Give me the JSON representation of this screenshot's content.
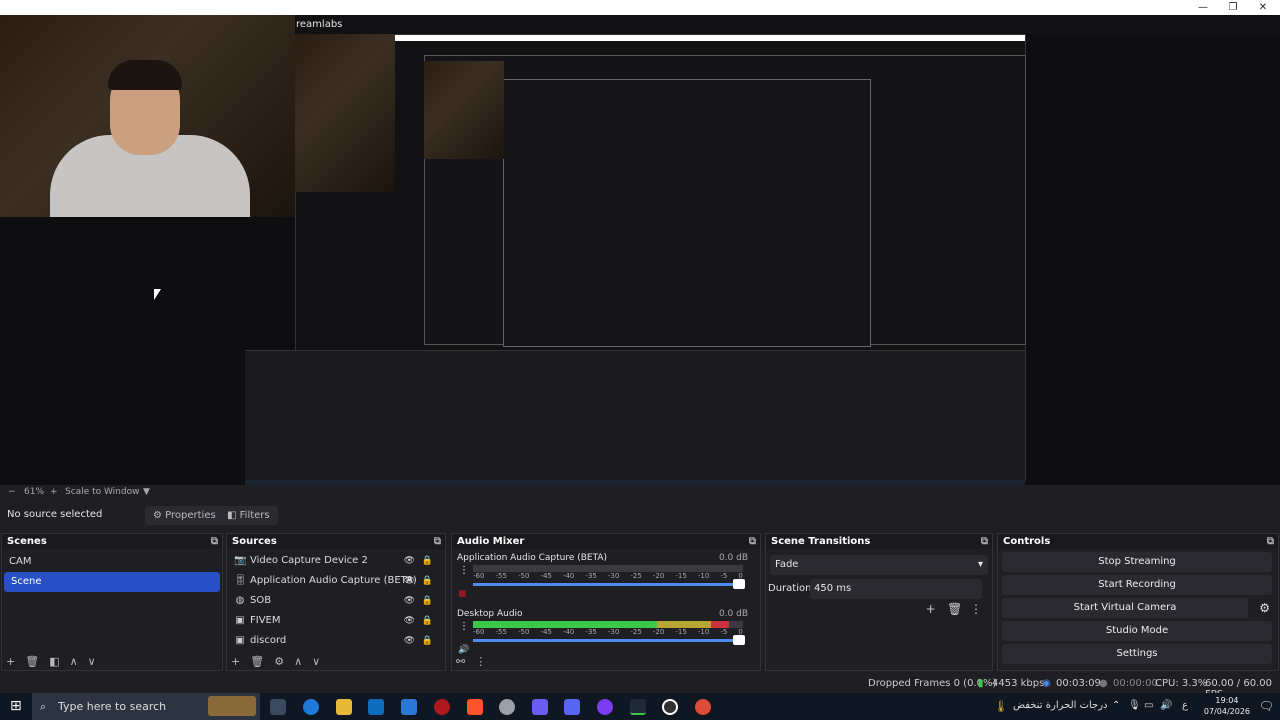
{
  "window": {
    "title": "reamlabs"
  },
  "controls_window": {
    "minimize": "—",
    "maximize": "❐",
    "close": "✕"
  },
  "zoom": {
    "minus": "−",
    "value": "61%",
    "plus": "+",
    "scale_mode": "Scale to Window"
  },
  "source_bar": {
    "status": "No source selected",
    "properties": "Properties",
    "filters": "Filters"
  },
  "scenes": {
    "title": "Scenes",
    "items": [
      {
        "label": "CAM"
      },
      {
        "label": "Scene"
      }
    ],
    "selected": 1
  },
  "sources": {
    "title": "Sources",
    "items": [
      {
        "label": "Video Capture Device 2",
        "icon": "camera-icon"
      },
      {
        "label": "Application Audio Capture (BETA)",
        "icon": "audio-icon"
      },
      {
        "label": "SOB",
        "icon": "globe-icon"
      },
      {
        "label": "FIVEM",
        "icon": "window-icon"
      },
      {
        "label": "discord",
        "icon": "window-icon"
      }
    ]
  },
  "audio_mixer": {
    "title": "Audio Mixer",
    "channels": [
      {
        "name": "Application Audio Capture (BETA)",
        "db": "0.0 dB",
        "level": 0.0
      },
      {
        "name": "Desktop Audio",
        "db": "0.0 dB",
        "level": 0.95
      }
    ],
    "scale": [
      "-60",
      "-55",
      "-50",
      "-45",
      "-40",
      "-35",
      "-30",
      "-25",
      "-20",
      "-15",
      "-10",
      "-5",
      "0"
    ]
  },
  "transitions": {
    "title": "Scene Transitions",
    "type": "Fade",
    "duration_label": "Duration",
    "duration": "450 ms"
  },
  "controls": {
    "title": "Controls",
    "buttons": [
      "Stop Streaming",
      "Start Recording",
      "Start Virtual Camera",
      "Studio Mode",
      "Settings"
    ]
  },
  "status": {
    "dropped": "Dropped Frames 0 (0.0%)",
    "bitrate": "4453 kbps",
    "live_time": "00:03:09",
    "rec_time": "00:00:00",
    "cpu": "CPU: 3.3%",
    "fps": "60.00 / 60.00 FPS"
  },
  "taskbar": {
    "search_placeholder": "Type here to search",
    "weather": "درجات الحرارة تنخفض",
    "lang": "ع",
    "time": "19:04",
    "date": "07/04/2026"
  },
  "colors": {
    "accent": "#2650c4",
    "meter_green": "#3cc94a",
    "meter_yellow": "#b8a632",
    "meter_red": "#c9323c"
  }
}
